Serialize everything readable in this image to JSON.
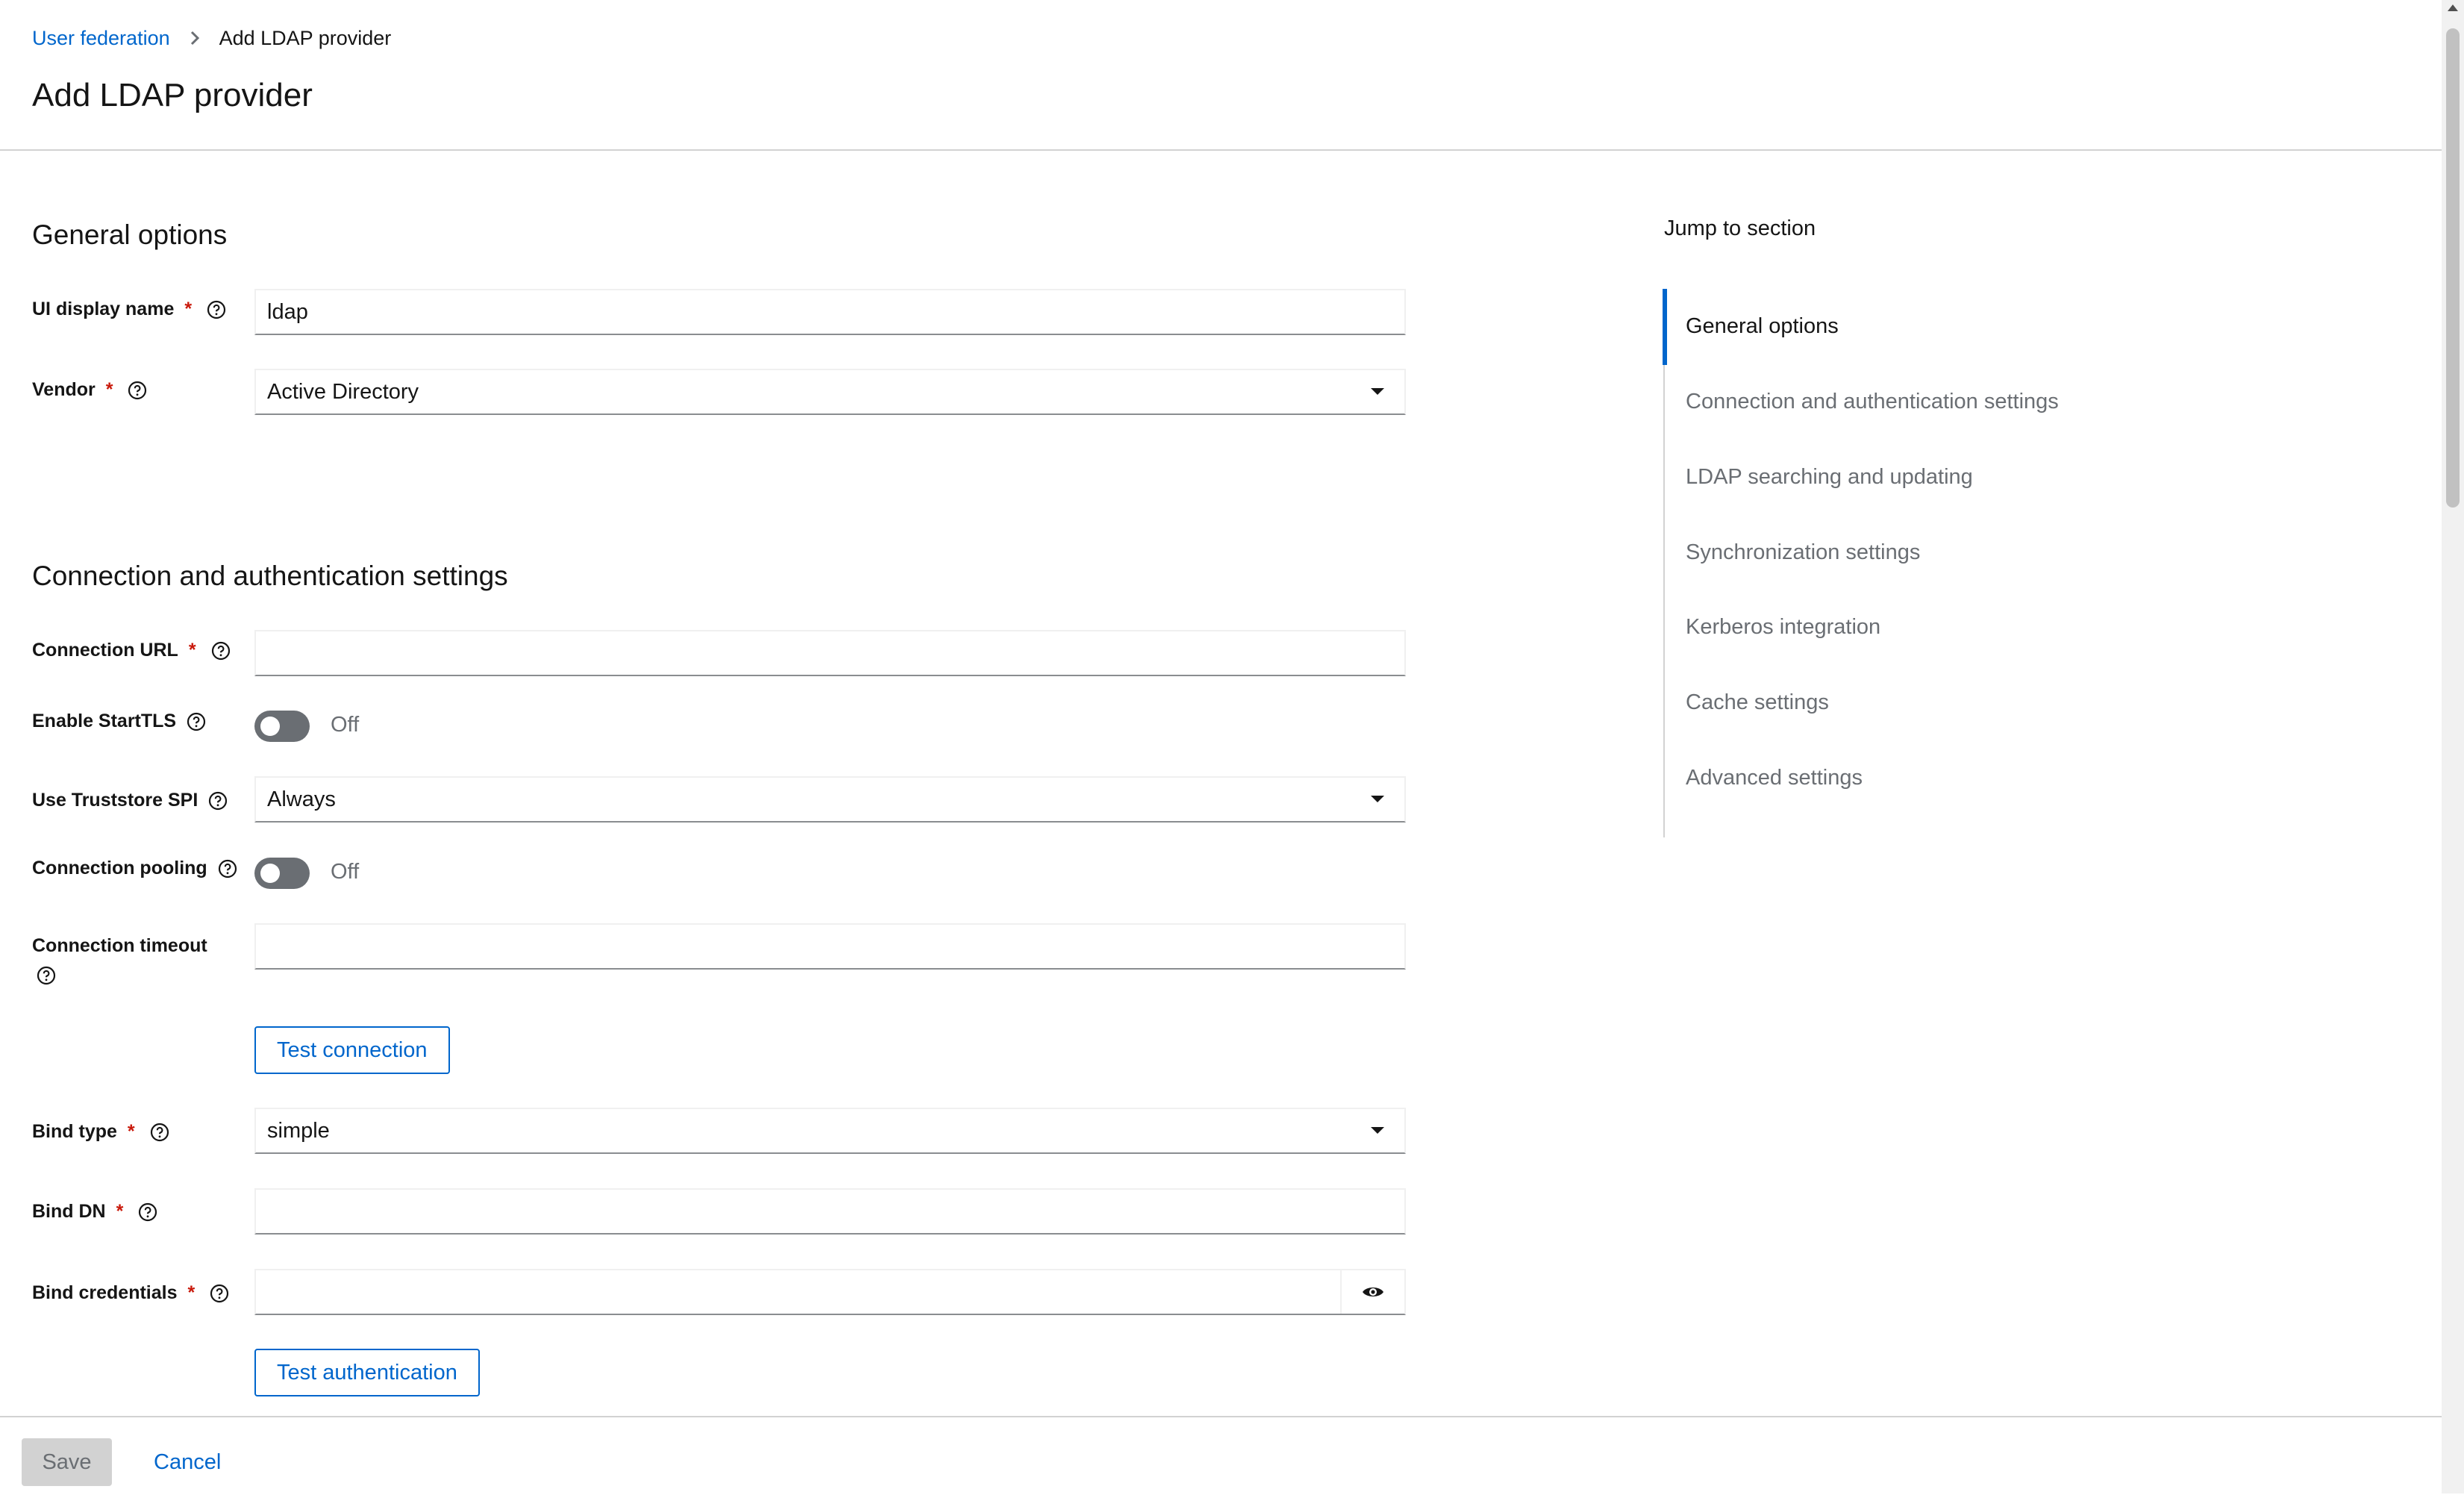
{
  "breadcrumb": {
    "parent": "User federation",
    "current": "Add LDAP provider"
  },
  "page_title": "Add LDAP provider",
  "general": {
    "title": "General options",
    "display_name": {
      "label": "UI display name",
      "value": "ldap"
    },
    "vendor": {
      "label": "Vendor",
      "value": "Active Directory"
    }
  },
  "connection": {
    "title": "Connection and authentication settings",
    "url": {
      "label": "Connection URL",
      "value": ""
    },
    "starttls": {
      "label": "Enable StartTLS",
      "state": "Off"
    },
    "truststore": {
      "label": "Use Truststore SPI",
      "value": "Always"
    },
    "pooling": {
      "label": "Connection pooling",
      "state": "Off"
    },
    "timeout": {
      "label": "Connection timeout",
      "value": ""
    },
    "test_connection_label": "Test connection",
    "bind_type": {
      "label": "Bind type",
      "value": "simple"
    },
    "bind_dn": {
      "label": "Bind DN",
      "value": ""
    },
    "bind_credentials": {
      "label": "Bind credentials",
      "value": ""
    },
    "test_auth_label": "Test authentication"
  },
  "required_mark": "*",
  "jump": {
    "title": "Jump to section",
    "items": [
      "General options",
      "Connection and authentication settings",
      "LDAP searching and updating",
      "Synchronization settings",
      "Kerberos integration",
      "Cache settings",
      "Advanced settings"
    ],
    "active": "General options"
  },
  "footer": {
    "save_label": "Save",
    "cancel_label": "Cancel"
  },
  "colors": {
    "link": "#0066cc",
    "required": "#c9190b",
    "muted": "#6a6e73"
  },
  "icons": [
    "chevron-right-icon",
    "help-circle-icon",
    "caret-down-icon",
    "eye-icon"
  ]
}
